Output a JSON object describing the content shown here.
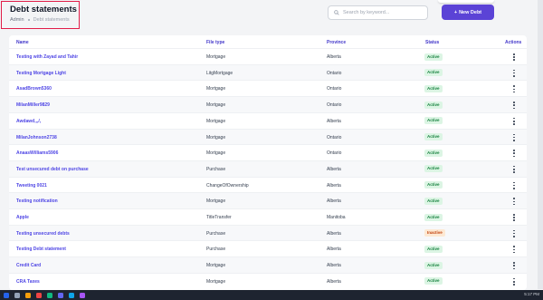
{
  "header": {
    "title": "Debt statements",
    "breadcrumb": [
      "Admin",
      "Debt statements"
    ]
  },
  "search": {
    "placeholder": "Search by keyword...",
    "value": ""
  },
  "new_button": {
    "label": "New Debt",
    "icon": "+"
  },
  "table": {
    "columns": [
      "Name",
      "File type",
      "Province",
      "Status",
      "Actions"
    ],
    "rows": [
      {
        "name": "Testing with Zayad and Tahir",
        "file_type": "Mortgage",
        "province": "Alberta",
        "status": "Active"
      },
      {
        "name": "Testing Mortgage Light",
        "file_type": "LitgMortgage",
        "province": "Ontario",
        "status": "Active"
      },
      {
        "name": "AsadBrown5360",
        "file_type": "Mortgage",
        "province": "Ontario",
        "status": "Active"
      },
      {
        "name": "MilanMiller9829",
        "file_type": "Mortgage",
        "province": "Ontario",
        "status": "Active"
      },
      {
        "name": "Awdawd,,,/,",
        "file_type": "Mortgage",
        "province": "Alberta",
        "status": "Active"
      },
      {
        "name": "MilanJohnson2738",
        "file_type": "Mortgage",
        "province": "Ontario",
        "status": "Active"
      },
      {
        "name": "AnaasWilliams5906",
        "file_type": "Mortgage",
        "province": "Ontario",
        "status": "Active"
      },
      {
        "name": "Test unsecured debt on purchase",
        "file_type": "Purchase",
        "province": "Alberta",
        "status": "Active"
      },
      {
        "name": "Tweeting 0021",
        "file_type": "ChangeOfOwnership",
        "province": "Alberta",
        "status": "Active"
      },
      {
        "name": "Testing notification",
        "file_type": "Mortgage",
        "province": "Alberta",
        "status": "Active"
      },
      {
        "name": "Apple",
        "file_type": "TitleTransfer",
        "province": "Manitoba",
        "status": "Active"
      },
      {
        "name": "Testing unsecured debts",
        "file_type": "Purchase",
        "province": "Alberta",
        "status": "Inactive"
      },
      {
        "name": "Testing Debt statement",
        "file_type": "Purchase",
        "province": "Alberta",
        "status": "Active"
      },
      {
        "name": "Credit Card",
        "file_type": "Mortgage",
        "province": "Alberta",
        "status": "Active"
      },
      {
        "name": "CRA Taxes",
        "file_type": "Mortgage",
        "province": "Alberta",
        "status": "Active"
      }
    ]
  },
  "taskbar": {
    "clock": "5:17 PM"
  },
  "colors": {
    "accent": "#5b43d6",
    "link": "#4f46e5",
    "active_bg": "#dcf5e4",
    "active_fg": "#15803d",
    "inactive_bg": "#fde9d3",
    "inactive_fg": "#c2410c",
    "highlight_border": "#e11d48"
  }
}
